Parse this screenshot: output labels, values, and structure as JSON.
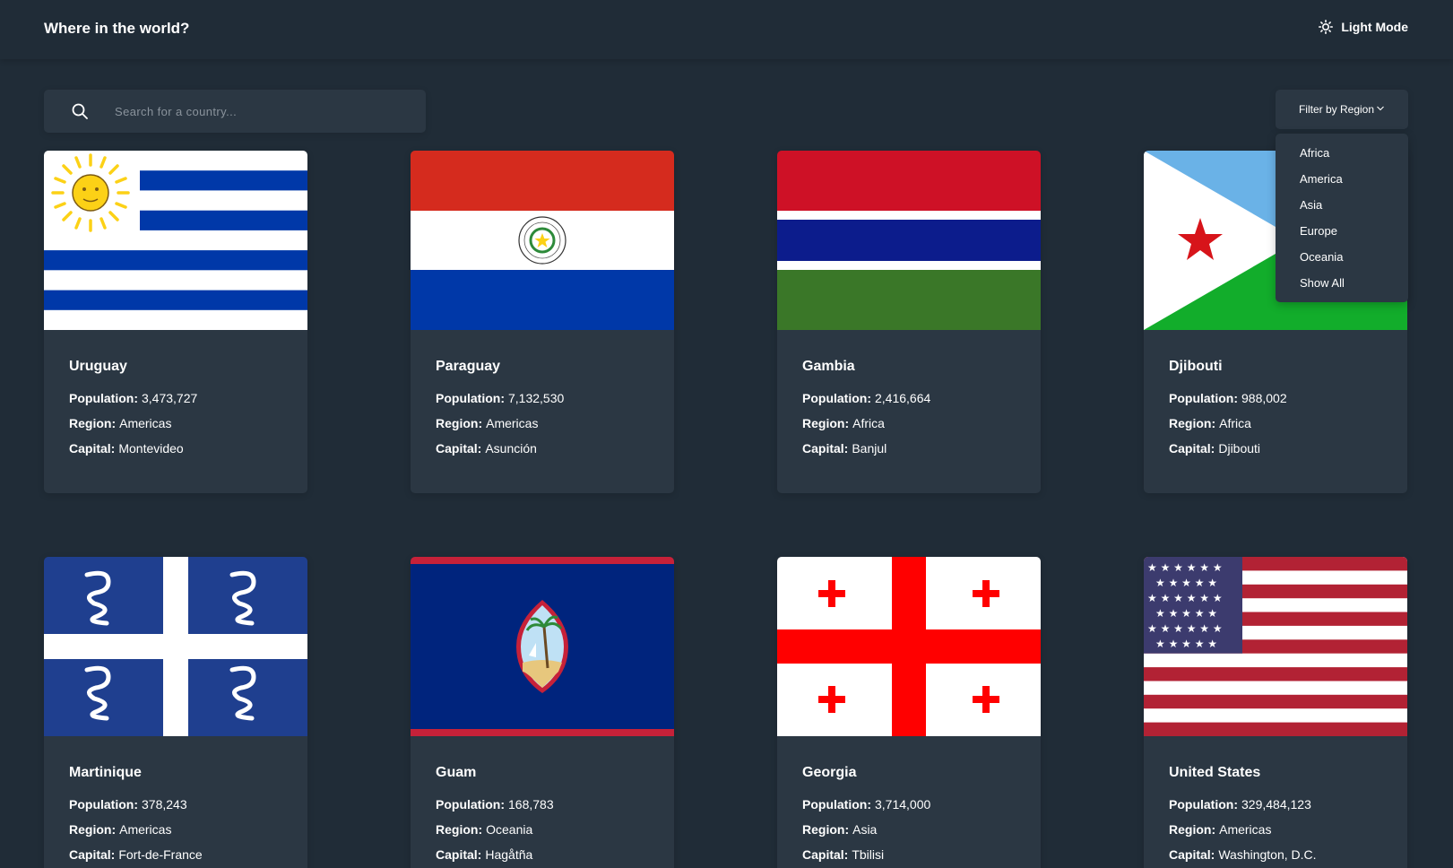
{
  "header": {
    "title": "Where in the world?",
    "theme_toggle_label": "Light Mode",
    "theme_icon": "sun-icon"
  },
  "search": {
    "placeholder": "Search for a country...",
    "value": "",
    "icon": "search-icon"
  },
  "filter": {
    "label": "Filter by Region",
    "icon": "chevron-down-icon",
    "options": [
      "Africa",
      "America",
      "Asia",
      "Europe",
      "Oceania",
      "Show All"
    ]
  },
  "labels": {
    "population": "Population:",
    "region": "Region:",
    "capital": "Capital:"
  },
  "countries": [
    {
      "name": "Uruguay",
      "population": "3,473,727",
      "region": "Americas",
      "capital": "Montevideo",
      "flag": "uruguay-flag"
    },
    {
      "name": "Paraguay",
      "population": "7,132,530",
      "region": "Americas",
      "capital": "Asunción",
      "flag": "paraguay-flag"
    },
    {
      "name": "Gambia",
      "population": "2,416,664",
      "region": "Africa",
      "capital": "Banjul",
      "flag": "gambia-flag"
    },
    {
      "name": "Djibouti",
      "population": "988,002",
      "region": "Africa",
      "capital": "Djibouti",
      "flag": "djibouti-flag"
    },
    {
      "name": "Martinique",
      "population": "378,243",
      "region": "Americas",
      "capital": "Fort-de-France",
      "flag": "martinique-flag"
    },
    {
      "name": "Guam",
      "population": "168,783",
      "region": "Oceania",
      "capital": "Hagåtña",
      "flag": "guam-flag"
    },
    {
      "name": "Georgia",
      "population": "3,714,000",
      "region": "Asia",
      "capital": "Tbilisi",
      "flag": "georgia-flag"
    },
    {
      "name": "United States",
      "population": "329,484,123",
      "region": "Americas",
      "capital": "Washington, D.C.",
      "flag": "united-states-flag"
    }
  ],
  "colors": {
    "background": "#202c37",
    "element": "#2b3743",
    "text": "#ffffff"
  }
}
